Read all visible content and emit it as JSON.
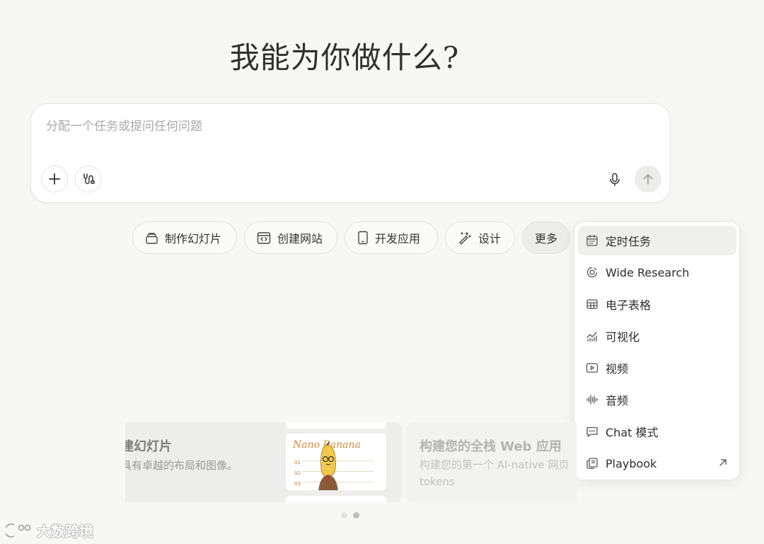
{
  "heading": "我能为你做什么?",
  "composer": {
    "placeholder": "分配一个任务或提问任何问题",
    "value": ""
  },
  "chips": [
    {
      "label": "制作幻灯片",
      "icon": "stack-icon"
    },
    {
      "label": "创建网站",
      "icon": "code-window-icon"
    },
    {
      "label": "开发应用",
      "icon": "phone-icon"
    },
    {
      "label": "设计",
      "icon": "magic-wand-icon"
    },
    {
      "label": "更多",
      "icon": ""
    }
  ],
  "menu": {
    "items": [
      {
        "label": "定时任务",
        "icon": "calendar-icon"
      },
      {
        "label": "Wide Research",
        "icon": "radar-icon"
      },
      {
        "label": "电子表格",
        "icon": "table-icon"
      },
      {
        "label": "可视化",
        "icon": "chart-icon"
      },
      {
        "label": "视频",
        "icon": "video-icon"
      },
      {
        "label": "音频",
        "icon": "waveform-icon"
      },
      {
        "label": "Chat 模式",
        "icon": "chat-icon"
      },
      {
        "label": "Playbook",
        "icon": "playbook-icon"
      }
    ]
  },
  "cards": [
    {
      "title": "建幻灯片",
      "desc": "具有卓越的布局和图像。",
      "thumb_text": "Nano Banana",
      "thumb_lines": [
        "01",
        "02",
        "03"
      ]
    },
    {
      "title": "构建您的全栈 Web 应用",
      "desc": "构建您的第一个 AI-native 网页 tokens"
    }
  ],
  "pagination": {
    "total": 2,
    "active": 2
  },
  "watermark": "大数跨境",
  "colors": {
    "background": "#f7f7f5",
    "accent_text": "#2e2e2e",
    "banana": "#f2c94c"
  }
}
